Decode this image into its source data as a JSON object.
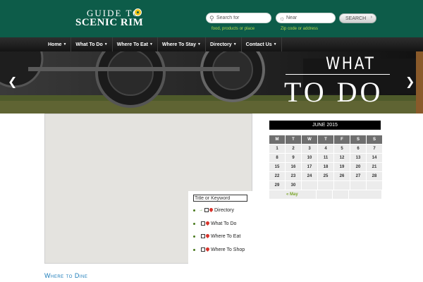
{
  "header": {
    "logo_line1": "GUIDE TO",
    "logo_line2": "SCENIC RIM",
    "search_what_placeholder": "Search for",
    "search_what_hint": "food, products or place",
    "search_where_placeholder": "Near",
    "search_where_hint": "Zip code or address",
    "search_button": "SEARCH",
    "search_icon": "search-icon",
    "location_icon": "sun-location-icon"
  },
  "nav": {
    "items": [
      "Home",
      "What To Do",
      "Where To Eat",
      "Where To Stay",
      "Directory",
      "Contact Us"
    ]
  },
  "hero": {
    "title_top": "WHAT",
    "title_bottom": "TO DO",
    "prev_icon": "chevron-left-icon",
    "next_icon": "chevron-right-icon"
  },
  "map": {
    "keyword_placeholder": "Title or Keyword",
    "filters": [
      "Directory",
      "What To Do",
      "Where To Eat",
      "Where To Shop"
    ]
  },
  "calendar": {
    "month": "JUNE 2015",
    "weekdays": [
      "M",
      "T",
      "W",
      "T",
      "F",
      "S",
      "S"
    ],
    "weeks": [
      [
        "1",
        "2",
        "3",
        "4",
        "5",
        "6",
        "7"
      ],
      [
        "8",
        "9",
        "10",
        "11",
        "12",
        "13",
        "14"
      ],
      [
        "15",
        "16",
        "17",
        "18",
        "19",
        "20",
        "21"
      ],
      [
        "22",
        "23",
        "24",
        "25",
        "26",
        "27",
        "28"
      ],
      [
        "29",
        "30",
        "",
        "",
        "",
        "",
        ""
      ]
    ],
    "prev_label": "« May"
  },
  "section": {
    "heading": "Where to Dine"
  },
  "colors": {
    "header_bg": "#0d5c49",
    "accent_green": "#b6d84a",
    "link_blue": "#1a7bb9"
  }
}
